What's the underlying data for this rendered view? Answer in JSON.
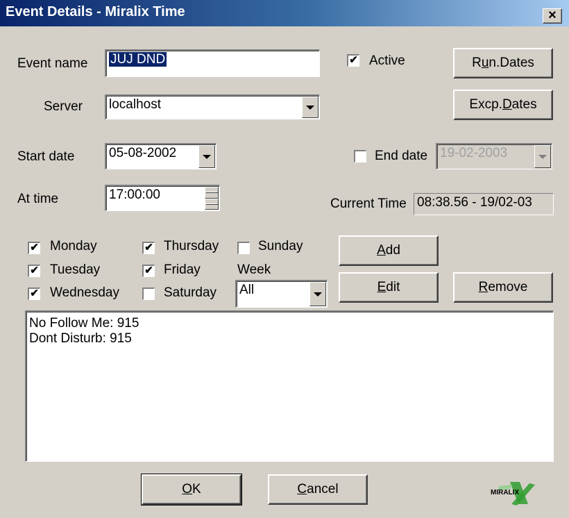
{
  "window": {
    "title": "Event Details - Miralix Time",
    "close_label": "×"
  },
  "form": {
    "event_name_label": "Event name",
    "event_name_value": "JUJ DND",
    "active_label": "Active",
    "active_checked": true,
    "server_label": "Server",
    "server_value": "localhost",
    "start_date_label": "Start date",
    "start_date_value": "05-08-2002",
    "end_date_label": "End date",
    "end_date_checked": false,
    "end_date_value": "19-02-2003",
    "at_time_label": "At time",
    "at_time_value": "17:00:00",
    "current_time_label": "Current Time",
    "current_time_value": "08:38.56 - 19/02-03"
  },
  "buttons": {
    "run_dates": {
      "pre": "R",
      "mn": "u",
      "post": "n.Dates"
    },
    "excp_dates": {
      "pre": "Excp.",
      "mn": "D",
      "post": "ates"
    },
    "add": {
      "pre": "",
      "mn": "A",
      "post": "dd"
    },
    "edit": {
      "pre": "",
      "mn": "E",
      "post": "dit"
    },
    "remove": {
      "pre": "",
      "mn": "R",
      "post": "emove"
    },
    "ok": {
      "pre": "",
      "mn": "O",
      "post": "K"
    },
    "cancel": {
      "pre": "",
      "mn": "C",
      "post": "ancel"
    }
  },
  "days": {
    "monday": {
      "label": "Monday",
      "checked": true
    },
    "tuesday": {
      "label": "Tuesday",
      "checked": true
    },
    "wednesday": {
      "label": "Wednesday",
      "checked": true
    },
    "thursday": {
      "label": "Thursday",
      "checked": true
    },
    "friday": {
      "label": "Friday",
      "checked": true
    },
    "saturday": {
      "label": "Saturday",
      "checked": false
    },
    "sunday": {
      "label": "Sunday",
      "checked": false
    }
  },
  "week": {
    "label": "Week",
    "value": "All"
  },
  "actions_list": [
    "No Follow Me: 915",
    "Dont Disturb: 915"
  ],
  "logo": {
    "text": "MIRALIX",
    "colors": {
      "accent": "#2f9e2f",
      "text": "#000000"
    }
  }
}
